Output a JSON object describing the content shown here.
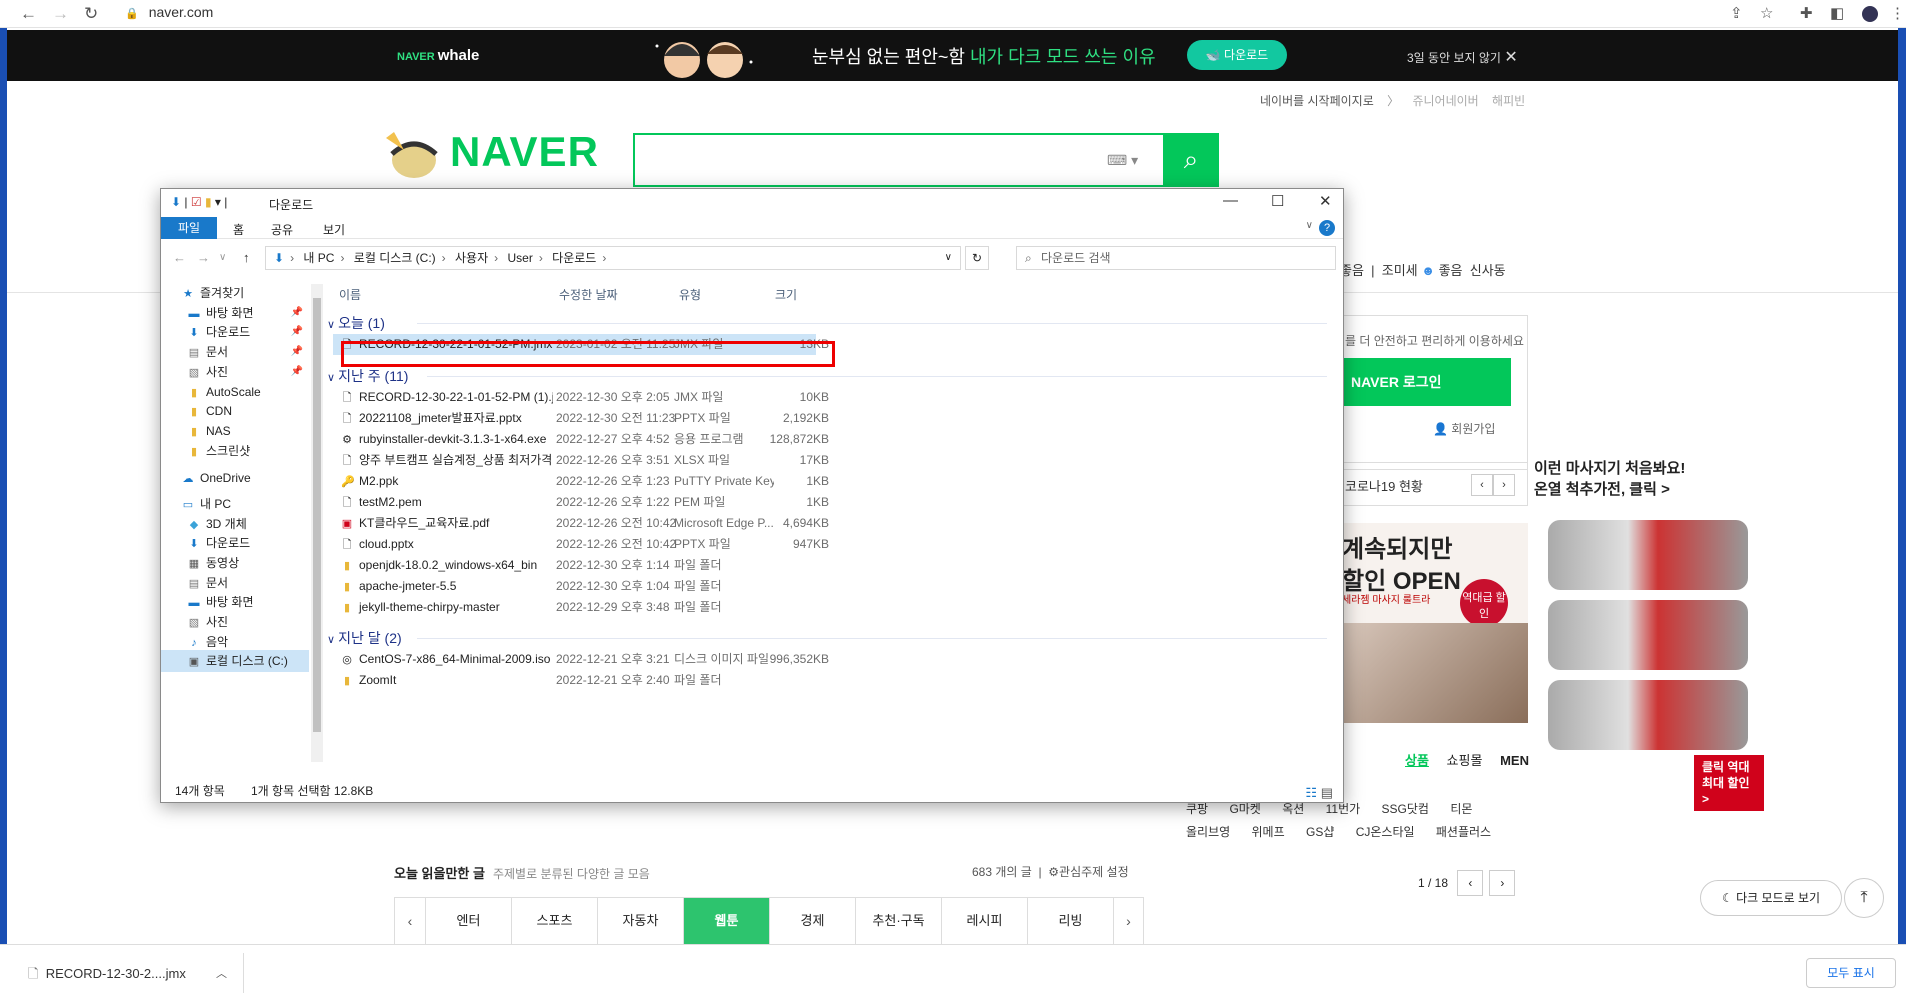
{
  "browser": {
    "url": "naver.com",
    "lock_icon": "lock-icon"
  },
  "banner": {
    "brand_small": "NAVER",
    "brand": "whale",
    "message_plain": "눈부심 없는 편안~함 ",
    "message_highlight": "내가 다크 모드 쓰는 이유",
    "download_label": "다운로드",
    "hide_label": "3일 동안 보지 않기"
  },
  "naver": {
    "logo": "NAVER",
    "top_links": [
      "네이버를 시작페이지로",
      "쥬니어네이버",
      "해피빈"
    ],
    "weather": [
      "좋음",
      "조미세",
      "좋음",
      "신사동"
    ],
    "login_tip": "를 더 안전하고 편리하게 이용하세요",
    "login_button": "NAVER 로그인",
    "join_label": "회원가입",
    "covid_label": "코로나19 현황",
    "ad_line1": "계속되지만",
    "ad_line2": "할인 OPEN",
    "ad_line3": "세라젬 마사지 룰트라",
    "ad_badge": "역대급 할인",
    "right_ad_line1": "이런 마사지기 처음봐요!",
    "right_ad_line2": "온열 척추가전, 클릭 >",
    "right_ad_cta": "클릭 역대 최대 할인 >",
    "shop_tabs": [
      "상품",
      "쇼핑몰",
      "MEN"
    ],
    "shop_row1": [
      "쿠팡",
      "G마켓",
      "옥션",
      "11번가",
      "SSG닷컴",
      "티몬"
    ],
    "shop_row2": [
      "올리브영",
      "위메프",
      "GS샵",
      "CJ온스타일",
      "패션플러스"
    ],
    "shop_pager": "1 / 18",
    "today_title": "오늘 읽을만한 글",
    "today_sub": "주제별로 분류된 다양한 글 모음",
    "today_count": "683 개의 글",
    "today_setting": "관심주제 설정",
    "categories": [
      "엔터",
      "스포츠",
      "자동차",
      "웹툰",
      "경제",
      "추천·구독",
      "레시피",
      "리빙"
    ],
    "active_category": "웹툰",
    "dark_mode": "다크 모드로 보기"
  },
  "download_bar": {
    "file": "RECORD-12-30-2....jmx",
    "show_all": "모두 표시"
  },
  "explorer": {
    "title": "다운로드",
    "ribbon_tabs": [
      "파일",
      "홈",
      "공유",
      "보기"
    ],
    "path": [
      "내 PC",
      "로컬 디스크 (C:)",
      "사용자",
      "User",
      "다운로드"
    ],
    "search_placeholder": "다운로드 검색",
    "columns": [
      "이름",
      "수정한 날짜",
      "유형",
      "크기"
    ],
    "nav_items": [
      {
        "label": "즐겨찾기",
        "icon": "star-icon",
        "pinned": false
      },
      {
        "label": "바탕 화면",
        "icon": "desktop-icon",
        "pinned": true
      },
      {
        "label": "다운로드",
        "icon": "download-icon",
        "pinned": true
      },
      {
        "label": "문서",
        "icon": "document-icon",
        "pinned": true
      },
      {
        "label": "사진",
        "icon": "picture-icon",
        "pinned": true
      },
      {
        "label": "AutoScale",
        "icon": "folder-icon",
        "pinned": false
      },
      {
        "label": "CDN",
        "icon": "folder-icon",
        "pinned": false
      },
      {
        "label": "NAS",
        "icon": "folder-icon",
        "pinned": false
      },
      {
        "label": "스크린샷",
        "icon": "folder-icon",
        "pinned": false
      },
      {
        "label": "OneDrive",
        "icon": "cloud-icon",
        "pinned": false
      },
      {
        "label": "내 PC",
        "icon": "pc-icon",
        "pinned": false
      },
      {
        "label": "3D 개체",
        "icon": "cube-icon",
        "pinned": false
      },
      {
        "label": "다운로드",
        "icon": "download-icon",
        "pinned": false
      },
      {
        "label": "동영상",
        "icon": "video-icon",
        "pinned": false
      },
      {
        "label": "문서",
        "icon": "document-icon",
        "pinned": false
      },
      {
        "label": "바탕 화면",
        "icon": "desktop-icon",
        "pinned": false
      },
      {
        "label": "사진",
        "icon": "picture-icon",
        "pinned": false
      },
      {
        "label": "음악",
        "icon": "music-icon",
        "pinned": false
      },
      {
        "label": "로컬 디스크 (C:)",
        "icon": "drive-icon",
        "pinned": false
      }
    ],
    "groups": [
      {
        "label": "오늘 (1)",
        "files": [
          {
            "name": "RECORD-12-30-22-1-01-52-PM.jmx",
            "date": "2023-01-02 오전 11:25",
            "type": "JMX 파일",
            "size": "13KB",
            "icon": "file-icon"
          }
        ]
      },
      {
        "label": "지난 주 (11)",
        "files": [
          {
            "name": "RECORD-12-30-22-1-01-52-PM (1).jmx",
            "date": "2022-12-30 오후 2:05",
            "type": "JMX 파일",
            "size": "10KB",
            "icon": "file-icon"
          },
          {
            "name": "20221108_jmeter발표자료.pptx",
            "date": "2022-12-30 오전 11:23",
            "type": "PPTX 파일",
            "size": "2,192KB",
            "icon": "file-icon"
          },
          {
            "name": "rubyinstaller-devkit-3.1.3-1-x64.exe",
            "date": "2022-12-27 오후 4:52",
            "type": "응용 프로그램",
            "size": "128,872KB",
            "icon": "exe-icon"
          },
          {
            "name": "양주 부트캠프 실습계정_상품 최저가격 ...",
            "date": "2022-12-26 오후 3:51",
            "type": "XLSX 파일",
            "size": "17KB",
            "icon": "file-icon"
          },
          {
            "name": "M2.ppk",
            "date": "2022-12-26 오후 1:23",
            "type": "PuTTY Private Key...",
            "size": "1KB",
            "icon": "key-icon"
          },
          {
            "name": "testM2.pem",
            "date": "2022-12-26 오후 1:22",
            "type": "PEM 파일",
            "size": "1KB",
            "icon": "file-icon"
          },
          {
            "name": "KT클라우드_교육자료.pdf",
            "date": "2022-12-26 오전 10:42",
            "type": "Microsoft Edge P...",
            "size": "4,694KB",
            "icon": "pdf-icon"
          },
          {
            "name": "cloud.pptx",
            "date": "2022-12-26 오전 10:42",
            "type": "PPTX 파일",
            "size": "947KB",
            "icon": "file-icon"
          },
          {
            "name": "openjdk-18.0.2_windows-x64_bin",
            "date": "2022-12-30 오후 1:14",
            "type": "파일 폴더",
            "size": "",
            "icon": "folder-icon"
          },
          {
            "name": "apache-jmeter-5.5",
            "date": "2022-12-30 오후 1:04",
            "type": "파일 폴더",
            "size": "",
            "icon": "folder-icon"
          },
          {
            "name": "jekyll-theme-chirpy-master",
            "date": "2022-12-29 오후 3:48",
            "type": "파일 폴더",
            "size": "",
            "icon": "folder-icon"
          }
        ]
      },
      {
        "label": "지난 달 (2)",
        "files": [
          {
            "name": "CentOS-7-x86_64-Minimal-2009.iso",
            "date": "2022-12-21 오후 3:21",
            "type": "디스크 이미지 파일",
            "size": "996,352KB",
            "icon": "disc-icon"
          },
          {
            "name": "ZoomIt",
            "date": "2022-12-21 오후 2:40",
            "type": "파일 폴더",
            "size": "",
            "icon": "folder-icon"
          }
        ]
      }
    ],
    "status_count": "14개 항목",
    "status_selected": "1개 항목 선택함 12.8KB"
  }
}
